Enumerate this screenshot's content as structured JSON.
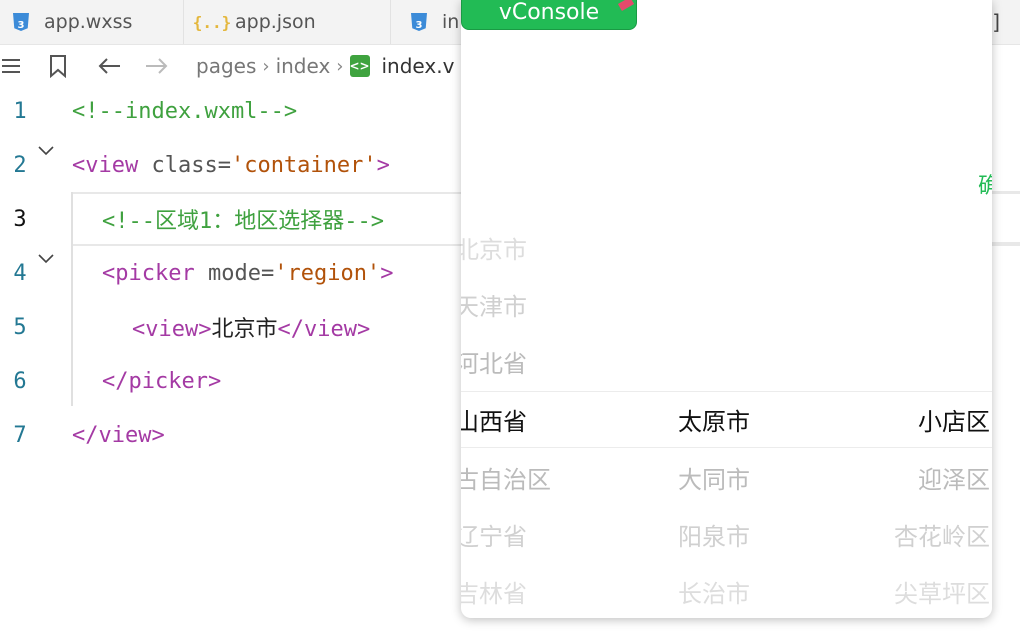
{
  "tabs": [
    {
      "label": "app.wxss",
      "icon": "css-file-icon",
      "badge": "3"
    },
    {
      "label": "app.json",
      "icon": "json-file-icon",
      "badge": "{..}"
    },
    {
      "label": "in",
      "icon": "css-file-icon",
      "badge": "3"
    }
  ],
  "tab_end_glyph": "]",
  "breadcrumb": {
    "items": [
      "pages",
      "index"
    ],
    "file": "index.v",
    "file_badge": "<>"
  },
  "editor": {
    "lines": [
      {
        "n": "1",
        "tokens": [
          {
            "t": "<!--index.wxml-->",
            "c": "comment"
          }
        ]
      },
      {
        "n": "2",
        "tokens": [
          {
            "t": "<",
            "c": "bracket"
          },
          {
            "t": "view",
            "c": "tag"
          },
          {
            "t": " class=",
            "c": "attr"
          },
          {
            "t": "'container'",
            "c": "str"
          },
          {
            "t": ">",
            "c": "bracket"
          }
        ]
      },
      {
        "n": "3",
        "tokens": [
          {
            "t": "<!--区域1：地区选择器-->",
            "c": "comment"
          }
        ]
      },
      {
        "n": "4",
        "tokens": [
          {
            "t": "<",
            "c": "bracket"
          },
          {
            "t": "picker",
            "c": "tag"
          },
          {
            "t": " mode=",
            "c": "attr"
          },
          {
            "t": "'region'",
            "c": "str"
          },
          {
            "t": ">",
            "c": "bracket"
          }
        ]
      },
      {
        "n": "5",
        "tokens": [
          {
            "t": "<",
            "c": "bracket"
          },
          {
            "t": "view",
            "c": "tag"
          },
          {
            "t": ">",
            "c": "bracket"
          },
          {
            "t": "北京市",
            "c": "text"
          },
          {
            "t": "</",
            "c": "bracket"
          },
          {
            "t": "view",
            "c": "tag"
          },
          {
            "t": ">",
            "c": "bracket"
          }
        ]
      },
      {
        "n": "6",
        "tokens": [
          {
            "t": "</",
            "c": "bracket"
          },
          {
            "t": "picker",
            "c": "tag"
          },
          {
            "t": ">",
            "c": "bracket"
          }
        ]
      },
      {
        "n": "7",
        "tokens": [
          {
            "t": "</",
            "c": "bracket"
          },
          {
            "t": "view",
            "c": "tag"
          },
          {
            "t": ">",
            "c": "bracket"
          }
        ]
      }
    ]
  },
  "simulator": {
    "vconsole_label": "vConsole",
    "confirm_partial": "确",
    "picker": {
      "provinces_above": [
        "北京市",
        "天津市",
        "河北省"
      ],
      "provinces_above_visible": [
        "北京市",
        "天津市",
        "河北省"
      ],
      "selected": {
        "province": "山西省",
        "city": "太原市",
        "district": "小店区"
      },
      "below": [
        {
          "province": "古自治区",
          "city": "大同市",
          "district": "迎泽区"
        },
        {
          "province": "辽宁省",
          "city": "阳泉市",
          "district": "杏花岭区"
        },
        {
          "province": "吉林省",
          "city": "长治市",
          "district": "尖草坪区"
        }
      ]
    }
  },
  "colors": {
    "comment": "#3fa13f",
    "tag": "#a43aa4",
    "string": "#b1520a",
    "line_number": "#237893",
    "vconsole": "#22bb55"
  }
}
